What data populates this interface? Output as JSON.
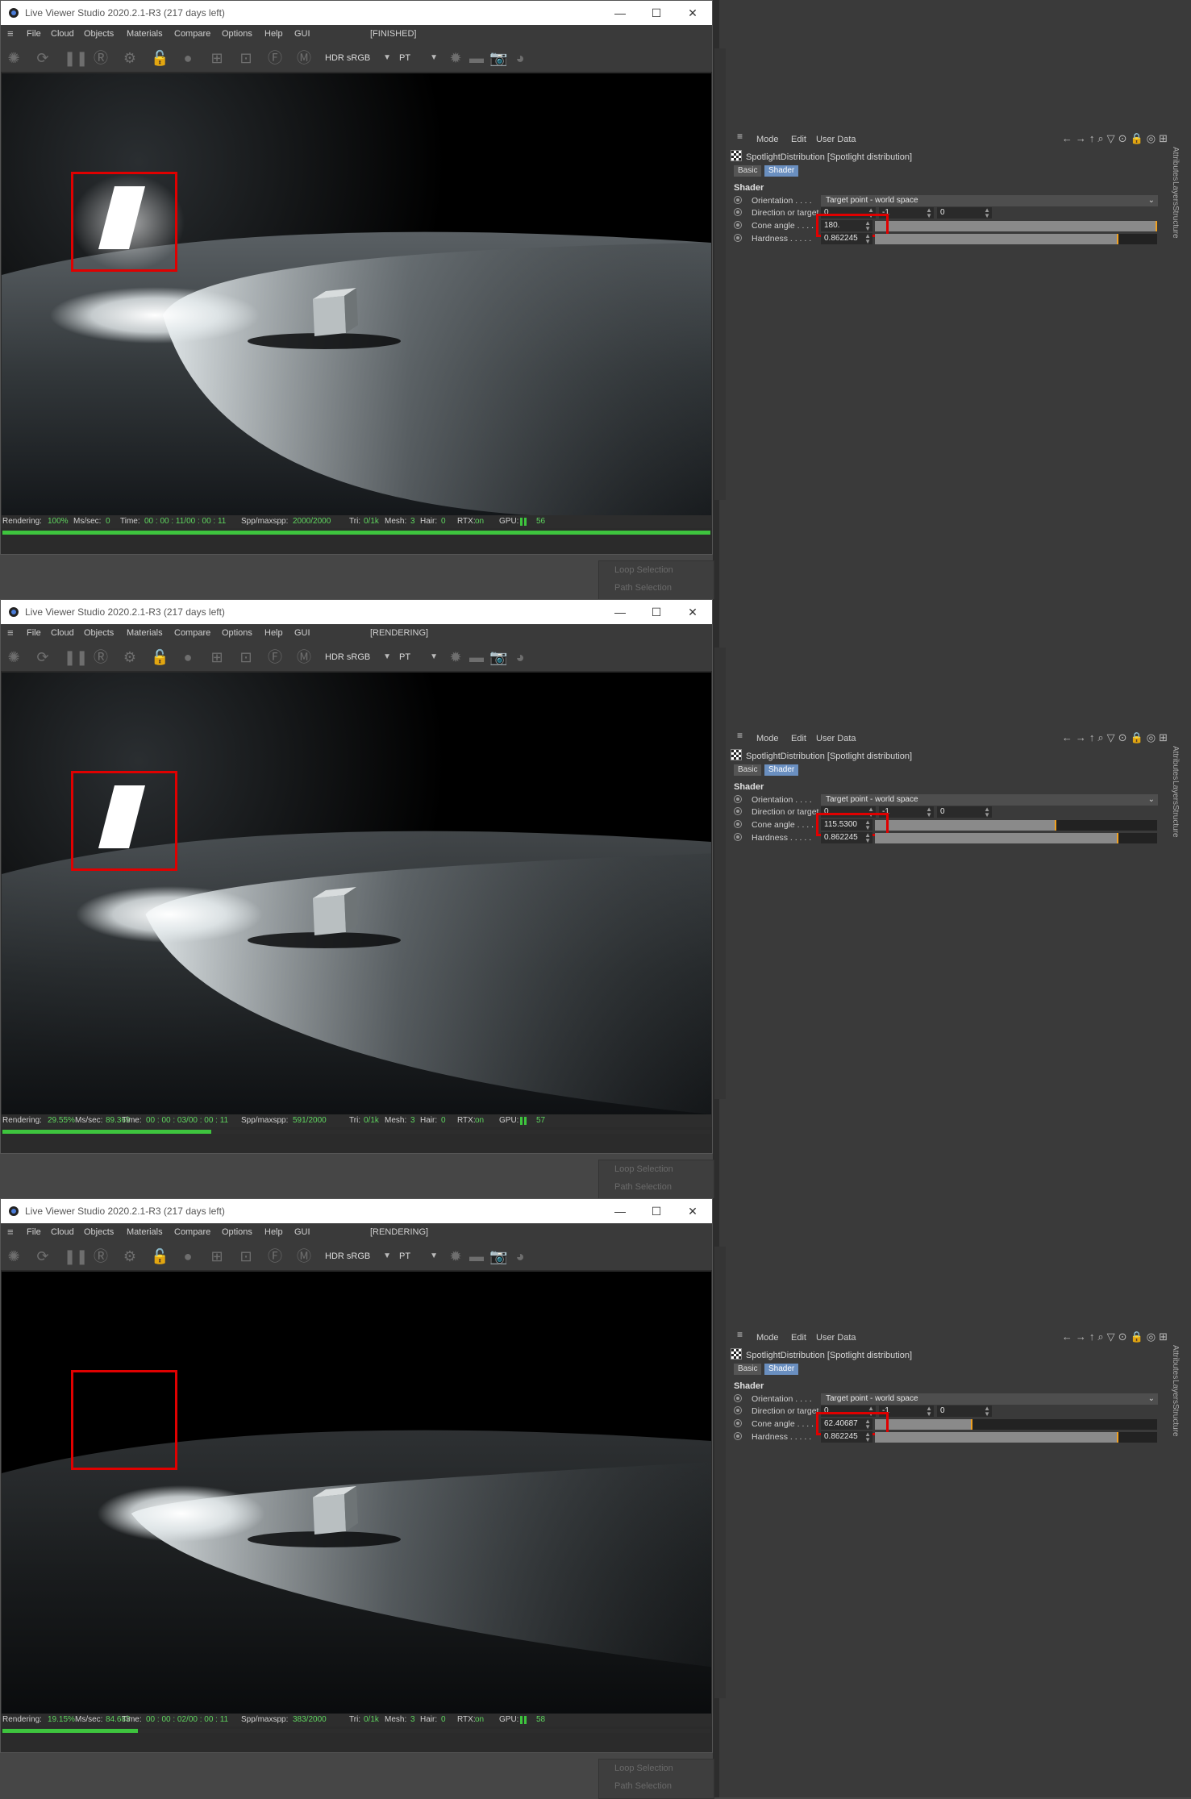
{
  "window": {
    "title": "Live Viewer Studio 2020.2.1-R3 (217 days left)",
    "minimize_glyph": "—",
    "maximize_glyph": "☐",
    "close_glyph": "✕"
  },
  "menu": [
    "File",
    "Cloud",
    "Objects",
    "Materials",
    "Compare",
    "Options",
    "Help",
    "GUI"
  ],
  "toolbar": {
    "color_space": "HDR sRGB",
    "kernel": "PT"
  },
  "status_labels": {
    "rendering": "Rendering:",
    "ms": "Ms/sec:",
    "time": "Time:",
    "spp": "Spp/maxspp:",
    "tri": "Tri:",
    "tri_val": "0/1k",
    "mesh": "Mesh:",
    "mesh_val": "3",
    "hair": "Hair:",
    "hair_val": "0",
    "rtx": "RTX:",
    "rtx_val": "on",
    "gpu": "GPU:"
  },
  "attr": {
    "menu": [
      "Mode",
      "Edit",
      "User Data"
    ],
    "object": "SpotlightDistribution [Spotlight distribution]",
    "tabs": [
      "Basic",
      "Shader"
    ],
    "section": "Shader",
    "orientation_label": "Orientation . . . .",
    "orientation_value": "Target point - world space",
    "direction_label": "Direction or target",
    "direction_values": [
      "0",
      "-1",
      "0"
    ],
    "cone_label": "Cone angle . . . .",
    "hardness_label": "Hardness . . . . .",
    "hardness_value": "0.862245",
    "side_tabs": [
      "Attributes",
      "Layers",
      "Structure"
    ]
  },
  "ghost_menu": [
    "Loop Selection",
    "Path Selection"
  ],
  "panels": [
    {
      "status": "[FINISHED]",
      "render_pct": "100%",
      "ms_sec": "0",
      "time": "00 : 00 : 11/00 : 00 : 11",
      "spp": "2000/2000",
      "gpu_temp": "56",
      "progress": 1.0,
      "cone_angle": "180.",
      "cone_fraction": 1.0,
      "hardness_fraction": 0.862,
      "light_visible": true
    },
    {
      "status": "[RENDERING]",
      "render_pct": "29.55%",
      "ms_sec": "89.369",
      "time": "00 : 00 : 03/00 : 00 : 11",
      "spp": "591/2000",
      "gpu_temp": "57",
      "progress": 0.2955,
      "cone_angle": "115.5300",
      "cone_fraction": 0.642,
      "hardness_fraction": 0.862,
      "light_visible": true
    },
    {
      "status": "[RENDERING]",
      "render_pct": "19.15%",
      "ms_sec": "84.683",
      "time": "00 : 00 : 02/00 : 00 : 11",
      "spp": "383/2000",
      "gpu_temp": "58",
      "progress": 0.1915,
      "cone_angle": "62.40687",
      "cone_fraction": 0.347,
      "hardness_fraction": 0.862,
      "light_visible": false
    }
  ]
}
